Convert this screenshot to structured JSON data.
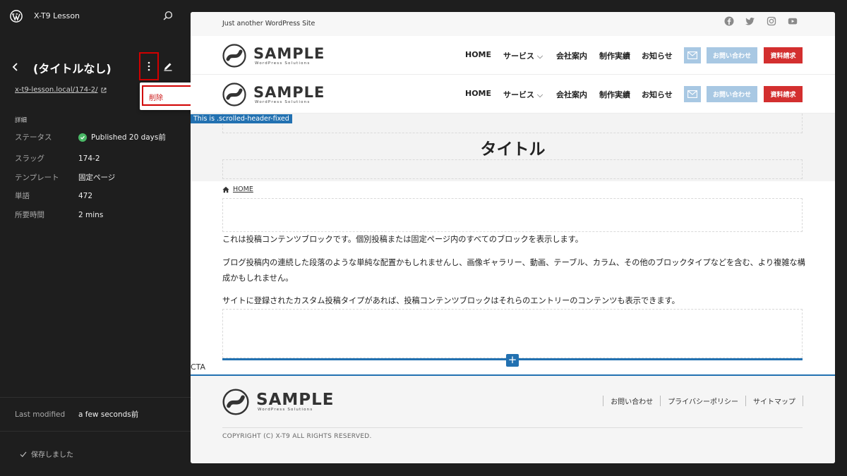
{
  "sidebar": {
    "site_title": "X-T9 Lesson",
    "page_title": "(タイトルなし)",
    "page_url": "x-t9-lesson.local/174-2/",
    "details_heading": "詳細",
    "details": [
      {
        "label": "ステータス",
        "value": "Published 20 days前"
      },
      {
        "label": "スラッグ",
        "value": "174-2"
      },
      {
        "label": "テンプレート",
        "value": "固定ページ"
      },
      {
        "label": "単語",
        "value": "472"
      },
      {
        "label": "所要時間",
        "value": "2 mins"
      }
    ],
    "last_modified_label": "Last modified",
    "last_modified_value": "a few seconds前",
    "saved_text": "保存しました",
    "dropdown_delete": "削除"
  },
  "canvas": {
    "tagline": "Just another WordPress Site",
    "logo_word": "SAMPLE",
    "logo_sub": "WordPress Solutions",
    "nav": [
      "HOME",
      "サービス",
      "会社案内",
      "制作実績",
      "お知らせ"
    ],
    "contact_button": "お問い合わせ",
    "request_button": "資料請求",
    "scrolled_label": "This is .scrolled-header-fixed",
    "heading": "タイトル",
    "breadcrumb_home": "HOME",
    "paragraphs": [
      "これは投稿コンテンツブロックです。個別投稿または固定ページ内のすべてのブロックを表示します。",
      "ブログ投稿内の連続した段落のような単純な配置かもしれませんし、画像ギャラリー、動画、テーブル、カラム、その他のブロックタイプなどを含む、より複雑な構成かもしれません。",
      "サイトに登録されたカスタム投稿タイプがあれば、投稿コンテンツブロックはそれらのエントリーのコンテンツも表示できます。"
    ],
    "cta_label": "CTA",
    "footer_nav": [
      "お問い合わせ",
      "プライバシーポリシー",
      "サイトマップ"
    ],
    "copyright": "COPYRIGHT (C) X-T9 ALL RIGHTS RESERVED."
  },
  "colors": {
    "sidebar_bg": "#1e1e1e",
    "accent_blue": "#2271b1",
    "danger_red": "#d10000",
    "status_green": "#4ab866",
    "contact_bg": "#a8c8e3",
    "request_bg": "#d32f2f"
  },
  "icons": [
    "wordpress-logo-icon",
    "search-icon",
    "chevron-left-icon",
    "more-vertical-icon",
    "pencil-icon",
    "external-link-icon",
    "check-circle-icon",
    "check-icon",
    "facebook-icon",
    "twitter-icon",
    "instagram-icon",
    "youtube-icon",
    "mail-icon",
    "home-icon",
    "plus-icon"
  ]
}
